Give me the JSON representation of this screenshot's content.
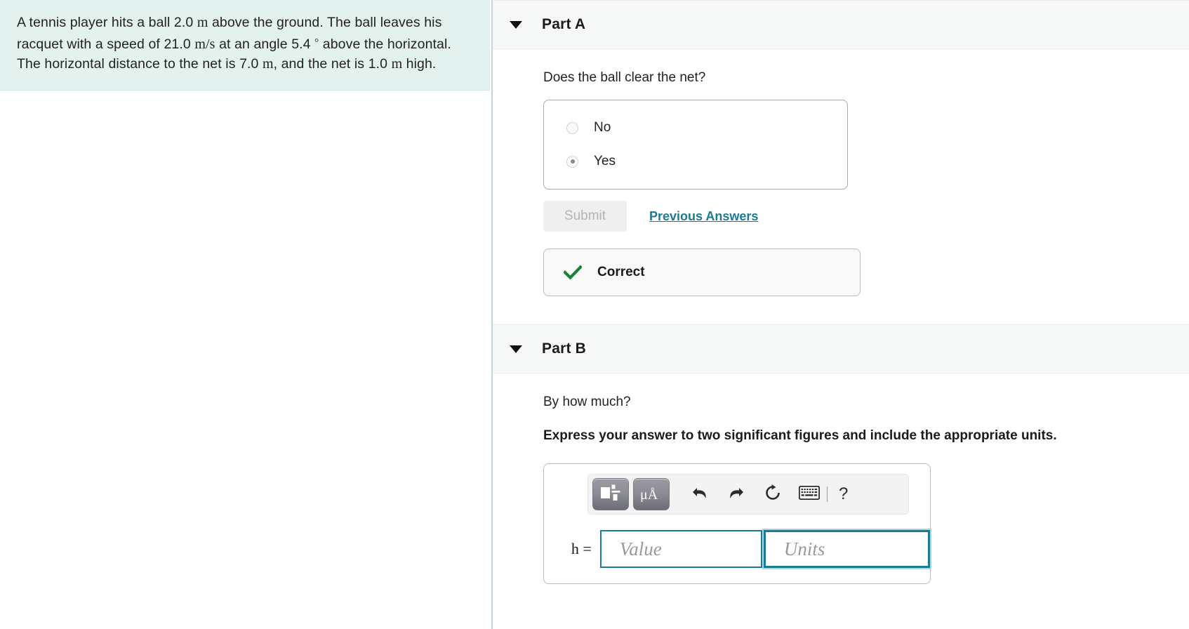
{
  "problem": {
    "sentence_1_a": "A tennis player hits a ball 2.0",
    "unit_m_1": "m",
    "sentence_1_b": "above the ground. The ball leaves his racquet with a speed of 21.0",
    "unit_ms": "m/s",
    "sentence_1_c": "at an angle 5.4",
    "degree_symbol": "°",
    "sentence_1_d": "above the horizontal. The horizontal distance to the net is 7.0",
    "unit_m_2": "m",
    "sentence_1_e": ", and the net is 1.0",
    "unit_m_3": "m",
    "sentence_1_f": "high."
  },
  "part_a": {
    "title": "Part A",
    "caret_icon": "caret-down-icon",
    "question": "Does the ball clear the net?",
    "choices": [
      {
        "label": "No",
        "selected": false
      },
      {
        "label": "Yes",
        "selected": true
      }
    ],
    "submit_label": "Submit",
    "submit_disabled": true,
    "previous_answers_label": "Previous Answers",
    "feedback": {
      "icon": "check-mark-icon",
      "icon_color": "#1a8238",
      "label": "Correct"
    }
  },
  "part_b": {
    "title": "Part B",
    "caret_icon": "caret-down-icon",
    "question": "By how much?",
    "instruction": "Express your answer to two significant figures and include the appropriate units.",
    "toolbar": {
      "buttons": [
        {
          "name": "template-layout-button",
          "icon": "template-icon",
          "label": ""
        },
        {
          "name": "units-button",
          "icon": "micro-angstrom-icon",
          "label": "μÅ"
        },
        {
          "name": "undo-button",
          "icon": "undo-arrow-icon"
        },
        {
          "name": "redo-button",
          "icon": "redo-arrow-icon"
        },
        {
          "name": "reset-button",
          "icon": "reset-circular-arrow-icon"
        },
        {
          "name": "keyboard-button",
          "icon": "keyboard-icon"
        },
        {
          "name": "help-button",
          "icon": "question-mark-icon",
          "label": "?"
        }
      ]
    },
    "entry": {
      "variable_label": "h =",
      "value_placeholder": "Value",
      "units_placeholder": "Units",
      "value_current": "",
      "units_current": "",
      "units_focused": true
    }
  },
  "colors": {
    "problem_background": "#e4f2ef",
    "link_teal": "#1a7b92",
    "field_border_teal": "#1a7b92",
    "correct_green": "#1a8238",
    "header_band": "#f7f8f8",
    "divider": "#c6d4de"
  }
}
